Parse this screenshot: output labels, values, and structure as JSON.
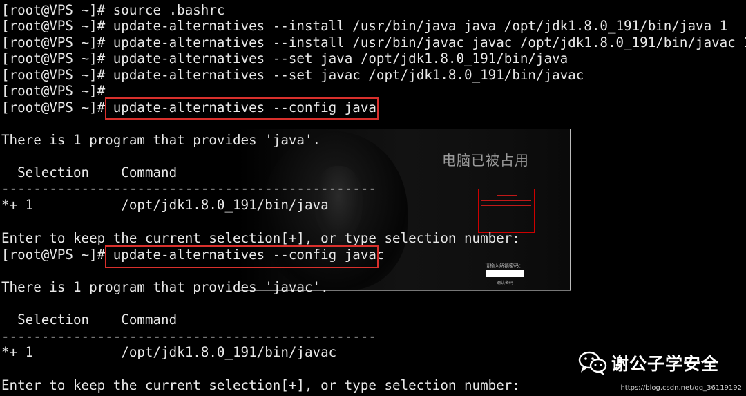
{
  "terminal": {
    "lines": [
      "[root@VPS ~]# source .bashrc",
      "[root@VPS ~]# update-alternatives --install /usr/bin/java java /opt/jdk1.8.0_191/bin/java 1",
      "[root@VPS ~]# update-alternatives --install /usr/bin/javac javac /opt/jdk1.8.0_191/bin/javac 1",
      "[root@VPS ~]# update-alternatives --set java /opt/jdk1.8.0_191/bin/java",
      "[root@VPS ~]# update-alternatives --set javac /opt/jdk1.8.0_191/bin/javac",
      "[root@VPS ~]#",
      "[root@VPS ~]# update-alternatives --config java",
      "",
      "There is 1 program that provides 'java'.",
      "",
      "  Selection    Command",
      "-----------------------------------------------",
      "*+ 1           /opt/jdk1.8.0_191/bin/java",
      "",
      "Enter to keep the current selection[+], or type selection number:",
      "[root@VPS ~]# update-alternatives --config javac",
      "",
      "There is 1 program that provides 'javac'.",
      "",
      "  Selection    Command",
      "-----------------------------------------------",
      "*+ 1           /opt/jdk1.8.0_191/bin/javac",
      "",
      "Enter to keep the current selection[+], or type selection number:"
    ]
  },
  "overlay": {
    "occupied_title": "电脑已被占用",
    "password_label": "请输入解锁密码：",
    "confirm_label": "确认密码"
  },
  "watermark": {
    "name": "谢公子学安全",
    "icon": "wechat-icon",
    "url": "https://blog.csdn.net/qq_36119192"
  },
  "colors": {
    "highlight": "#d9302c",
    "text": "#e8e8e8",
    "background": "#000000"
  }
}
